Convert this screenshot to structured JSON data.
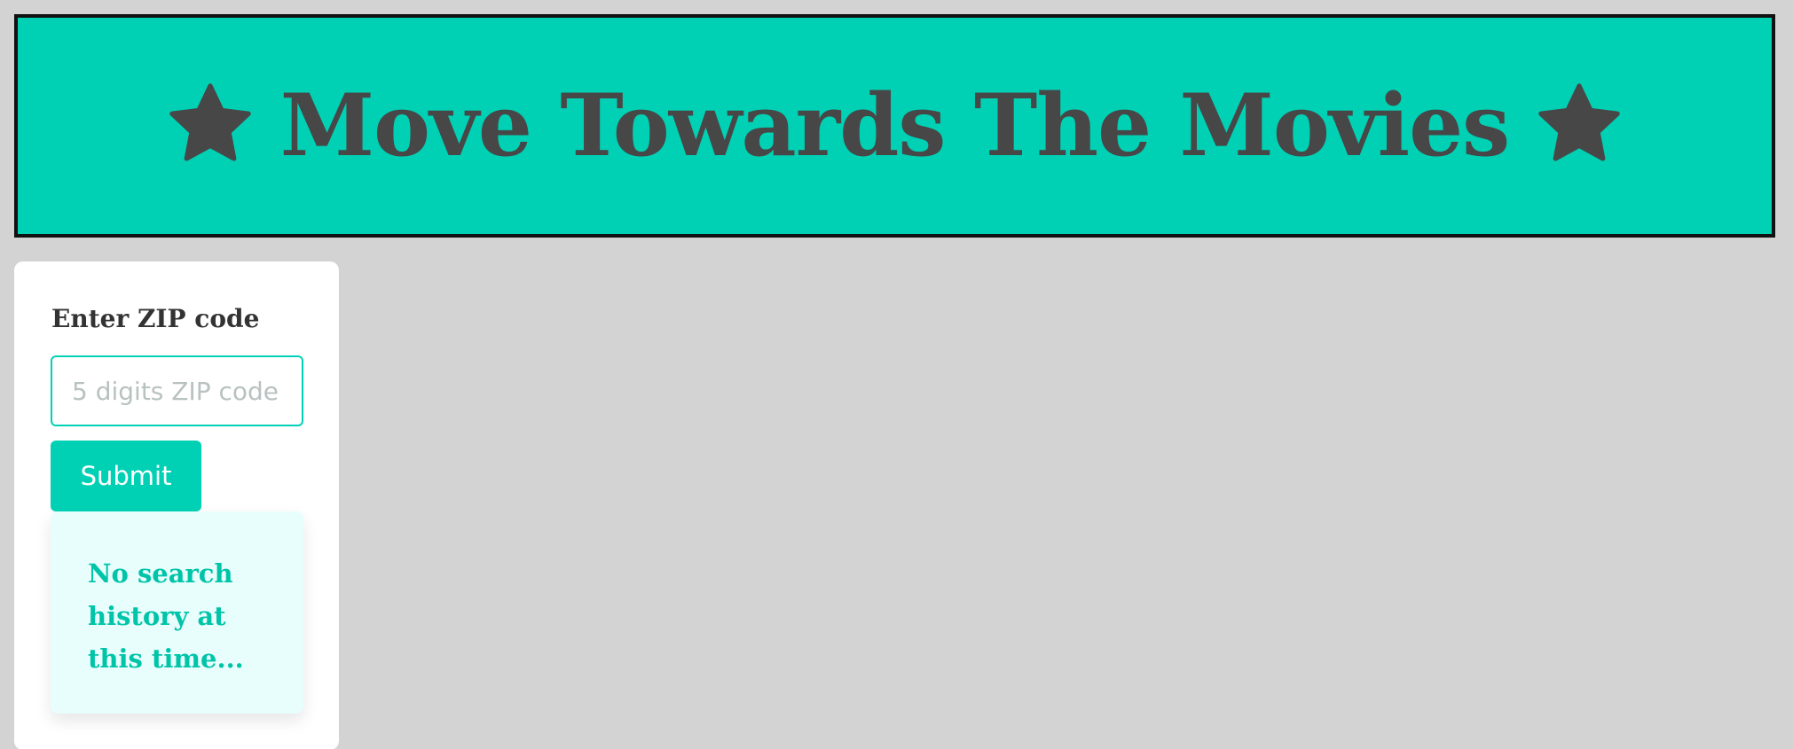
{
  "header": {
    "title": "Move Towards The Movies",
    "left_icon": "star-icon",
    "right_icon": "star-icon",
    "background": "#00d1b5",
    "text_color": "#474747"
  },
  "search": {
    "label": "Enter ZIP code",
    "placeholder": "5 digits ZIP code",
    "value": "",
    "submit_label": "Submit"
  },
  "history": {
    "empty_message": "No search history at this time..."
  },
  "colors": {
    "accent": "#00d1b5",
    "page_background": "#d3d3d3",
    "history_background": "#e8fefd"
  }
}
